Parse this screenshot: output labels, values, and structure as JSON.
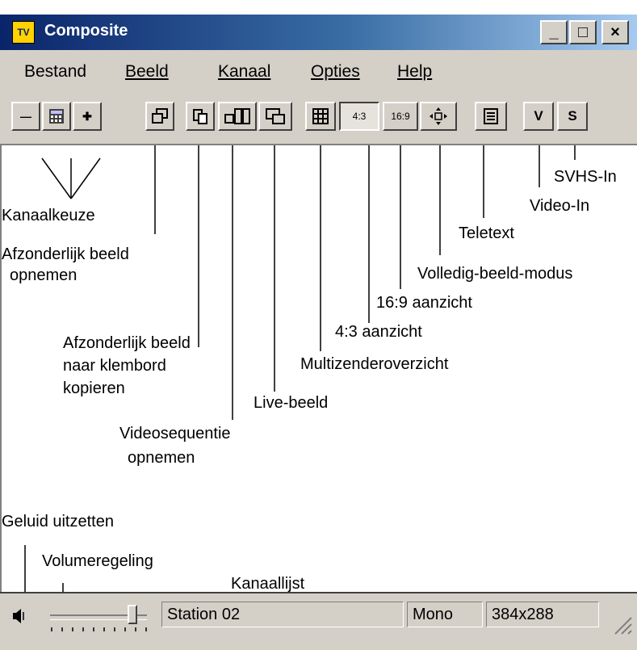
{
  "window": {
    "title": "Composite",
    "icon": "tv-icon"
  },
  "window_controls": {
    "minimize": "_",
    "maximize": "□",
    "close": "×"
  },
  "menu": [
    {
      "label": "Bestand"
    },
    {
      "label": "Beeld"
    },
    {
      "label": "Kanaal"
    },
    {
      "label": "Opties"
    },
    {
      "label": "Help"
    }
  ],
  "toolbar": [
    {
      "label": "—",
      "icon": "channel-down-icon"
    },
    {
      "label": "",
      "icon": "channel-grid-icon"
    },
    {
      "label": "✚",
      "icon": "channel-up-icon"
    },
    {
      "label": "",
      "icon": "capture-frame-icon"
    },
    {
      "label": "",
      "icon": "copy-clipboard-icon"
    },
    {
      "label": "",
      "icon": "record-video-icon"
    },
    {
      "label": "",
      "icon": "live-view-icon"
    },
    {
      "label": "",
      "icon": "multi-channel-grid-icon"
    },
    {
      "label": "4:3",
      "icon": "aspect-4-3-icon"
    },
    {
      "label": "16:9",
      "icon": "aspect-16-9-icon"
    },
    {
      "label": "",
      "icon": "fullscreen-move-icon"
    },
    {
      "label": "",
      "icon": "teletext-icon"
    },
    {
      "label": "V",
      "icon": "video-in-icon"
    },
    {
      "label": "S",
      "icon": "svhs-in-icon"
    }
  ],
  "annotations": {
    "kanaalkeuze": "Kanaalkeuze",
    "afzonderlijk_opnemen_1": "Afzonderlijk beeld",
    "afzonderlijk_opnemen_2": "opnemen",
    "klembord_1": "Afzonderlijk beeld",
    "klembord_2": "naar klembord",
    "klembord_3": "kopieren",
    "videosequentie_1": "Videosequentie",
    "videosequentie_2": "opnemen",
    "live": "Live-beeld",
    "multi": "Multizenderoverzicht",
    "a43": "4:3 aanzicht",
    "a169": "16:9 aanzicht",
    "volledig": "Volledig-beeld-modus",
    "teletext": "Teletext",
    "videoin": "Video-In",
    "svhsin": "SVHS-In",
    "geluid": "Geluid uitzetten",
    "volume": "Volumeregeling",
    "kanaallijst": "Kanaallijst"
  },
  "status": {
    "station": "Station 02",
    "audio": "Mono",
    "resolution": "384x288",
    "volume_level": 0.85
  }
}
